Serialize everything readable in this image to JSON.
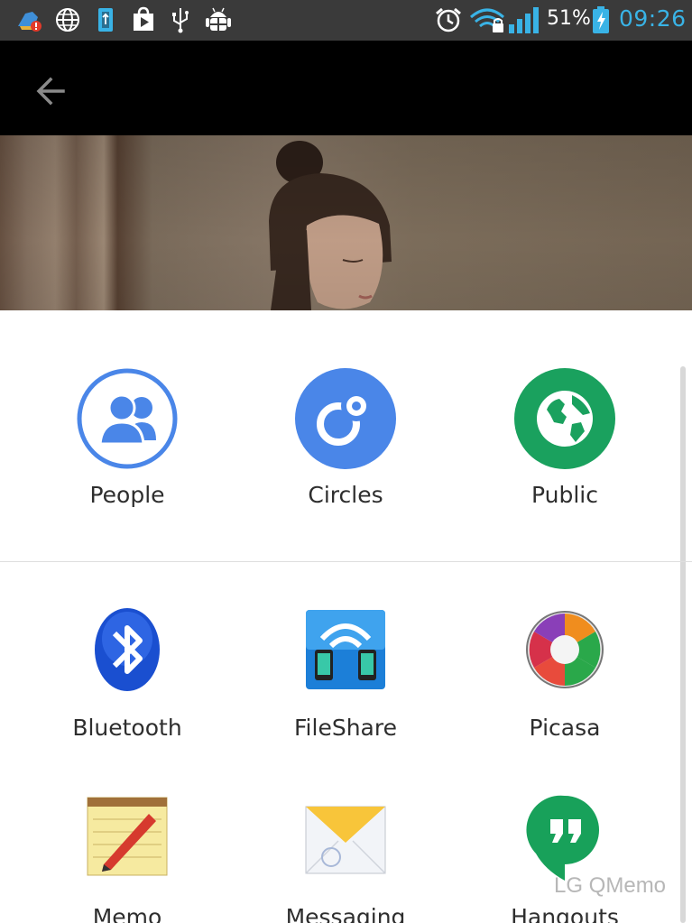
{
  "status_bar": {
    "battery_text": "51%",
    "time": "09:26",
    "icons": [
      "cleaner-alert-icon",
      "globe-icon",
      "usb-storage-icon",
      "play-store-icon",
      "usb-icon",
      "android-debug-icon",
      "alarm-icon",
      "wifi-locked-icon",
      "signal-icon",
      "battery-charging-icon"
    ]
  },
  "action_bar": {
    "back_icon": "arrow-left-icon"
  },
  "share_targets": {
    "people": {
      "label": "People"
    },
    "circles": {
      "label": "Circles"
    },
    "public": {
      "label": "Public"
    }
  },
  "apps": {
    "bluetooth": {
      "label": "Bluetooth"
    },
    "fileshare": {
      "label": "FileShare"
    },
    "picasa": {
      "label": "Picasa"
    },
    "memo": {
      "label": "Memo"
    },
    "messaging": {
      "label": "Messaging"
    },
    "hangouts": {
      "label": "Hangouts"
    }
  },
  "watermark": "LG QMemo",
  "colors": {
    "google_blue": "#4a86e8",
    "public_green": "#1aa15e",
    "time_blue": "#39b3e6",
    "status_bar": "#3a3a3a"
  }
}
